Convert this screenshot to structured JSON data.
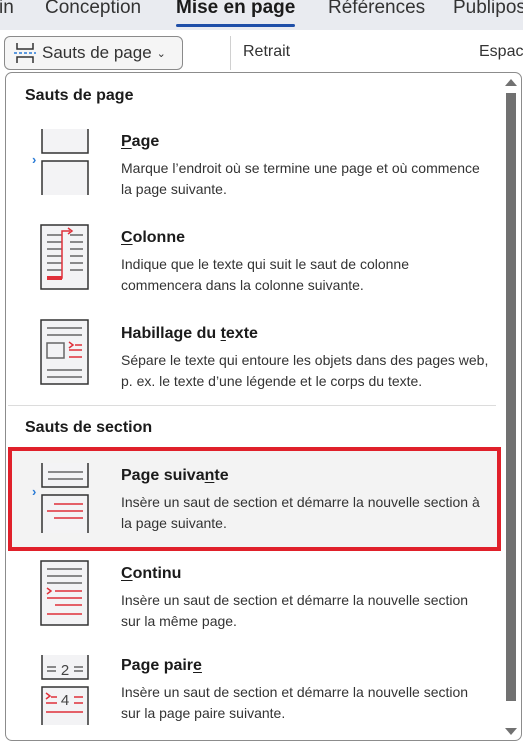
{
  "tabs": [
    {
      "label": "in"
    },
    {
      "label": "Conception"
    },
    {
      "label": "Mise en page",
      "active": true
    },
    {
      "label": "Références"
    },
    {
      "label": "Publipos"
    }
  ],
  "ribbon": {
    "breaks_button": "Sauts de page",
    "indent_label": "Retrait",
    "spacing_label": "Espac"
  },
  "menu": {
    "page_breaks_header": "Sauts de page",
    "section_breaks_header": "Sauts de section",
    "items": [
      {
        "pre": "",
        "key": "P",
        "post": "age",
        "desc": "Marque l’endroit où se termine une page et où commence la page suivante.",
        "icon": "page-break-icon"
      },
      {
        "pre": "",
        "key": "C",
        "post": "olonne",
        "desc": "Indique que le texte qui suit le saut de colonne commencera dans la colonne suivante.",
        "icon": "column-break-icon"
      },
      {
        "pre": "Habillage du ",
        "key": "t",
        "post": "exte",
        "desc": "Sépare le texte qui entoure les objets dans des pages web, p. ex. le texte d’une légende et le corps du texte.",
        "icon": "text-wrapping-icon"
      },
      {
        "pre": "Page suiva",
        "key": "n",
        "post": "te",
        "desc": "Insère un saut de section et démarre la nouvelle section à la page suivante.",
        "icon": "next-page-section-icon",
        "selected": true
      },
      {
        "pre": "",
        "key": "C",
        "post": "ontinu",
        "desc": "Insère un saut de section et démarre la nouvelle section sur la même page.",
        "icon": "continuous-section-icon"
      },
      {
        "pre": "Page pair",
        "key": "e",
        "post": "",
        "desc": "Insère un saut de section et démarre la nouvelle section sur la page paire suivante.",
        "icon": "even-page-section-icon"
      }
    ]
  },
  "colors": {
    "accent": "#1f4fa8",
    "highlight_border": "#e0202a",
    "icon_red": "#e0303a"
  }
}
